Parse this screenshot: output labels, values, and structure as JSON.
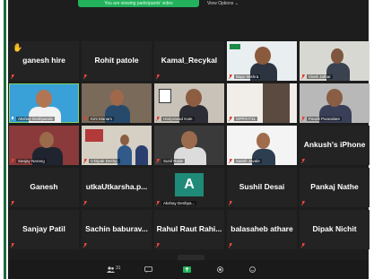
{
  "meeting": {
    "banner_text": "You are viewing participants' video",
    "view_options": "View Options ⌄"
  },
  "tiles": [
    {
      "label": "ganesh hire",
      "kind": "name",
      "hand": true
    },
    {
      "label": "Rohit patole",
      "kind": "name"
    },
    {
      "label": "Kamal_Recykal",
      "kind": "name"
    },
    {
      "label": "Bapu Mishra",
      "kind": "video"
    },
    {
      "label": "Vivek Jathar",
      "kind": "video"
    },
    {
      "label": "Akshay Deshpande",
      "kind": "video",
      "active": true
    },
    {
      "label": "Kirti Manam",
      "kind": "video"
    },
    {
      "label": "Hariprasad Kate",
      "kind": "video"
    },
    {
      "label": "OPPO F11",
      "kind": "video"
    },
    {
      "label": "Pandit Purandare",
      "kind": "video"
    },
    {
      "label": "Sanjay Narang",
      "kind": "video"
    },
    {
      "label": "V.Dipak Deshp.",
      "kind": "video"
    },
    {
      "label": "Sunil Rode",
      "kind": "video"
    },
    {
      "label": "Satish Javale",
      "kind": "video"
    },
    {
      "label": "Ankush's iPhone",
      "kind": "name"
    },
    {
      "label": "Ganesh",
      "kind": "name"
    },
    {
      "label": "utkaUtkarsha.p...",
      "kind": "name"
    },
    {
      "label": "Akshay Deshpa...",
      "kind": "avatar",
      "avatar_letter": "A"
    },
    {
      "label": "Sushil Desai",
      "kind": "name"
    },
    {
      "label": "Pankaj Nathe",
      "kind": "name"
    },
    {
      "label": "Sanjay Patil",
      "kind": "name"
    },
    {
      "label": "Sachin baburav...",
      "kind": "name"
    },
    {
      "label": "Rahul Raut Rahi...",
      "kind": "name"
    },
    {
      "label": "balasaheb athare",
      "kind": "name"
    },
    {
      "label": "Dipak Nichit",
      "kind": "name"
    }
  ],
  "toolbar": {
    "participants_count": "31",
    "icons": [
      "participants-icon",
      "chat-icon",
      "share-screen-icon",
      "record-icon",
      "reactions-icon"
    ]
  },
  "colors": {
    "background": "#1d1d1d",
    "tile": "#232323",
    "share_green": "#23b25b",
    "active_speaker": "#7fd46b",
    "muted_red": "#e0463a",
    "avatar_teal": "#1f8a78"
  }
}
